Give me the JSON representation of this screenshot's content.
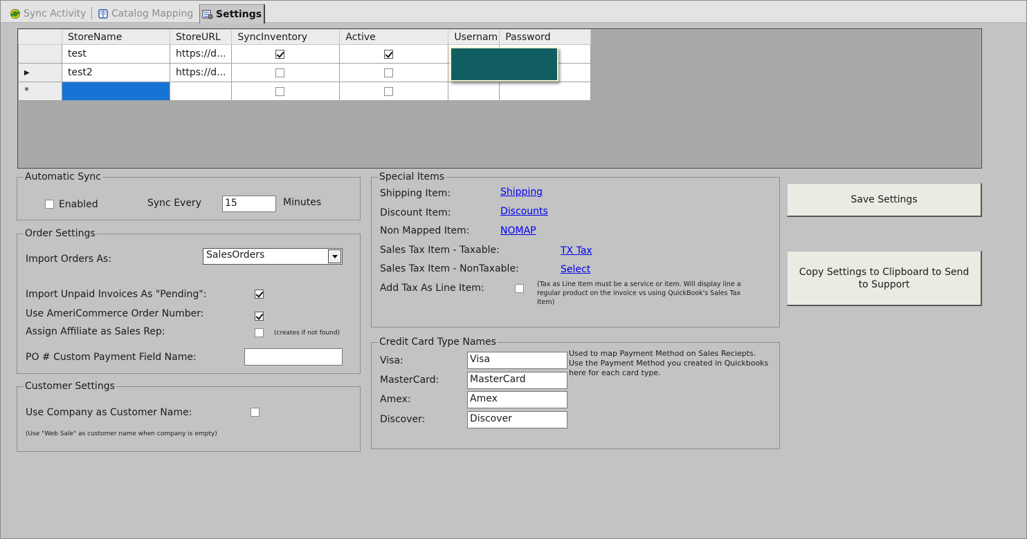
{
  "tabs": [
    {
      "label": "Sync Activity",
      "icon": "sync-icon"
    },
    {
      "label": "Catalog Mapping",
      "icon": "catalog-book-icon"
    },
    {
      "label": "Settings",
      "icon": "settings-icon"
    }
  ],
  "grid": {
    "columns": [
      "StoreName",
      "StoreURL",
      "SyncInventory",
      "Active",
      "Usernam",
      "Password"
    ],
    "rows": [
      {
        "row_marker": "",
        "store_name": "test",
        "store_url": "https://d...",
        "sync_inventory": true,
        "active": true
      },
      {
        "row_marker": "▶",
        "store_name": "test2",
        "store_url": "https://d...",
        "sync_inventory": false,
        "active": false
      },
      {
        "row_marker": "*",
        "store_name": "",
        "store_url": "",
        "sync_inventory": false,
        "active": false
      }
    ]
  },
  "automatic_sync": {
    "title": "Automatic Sync",
    "enabled_label": "Enabled",
    "enabled": false,
    "sync_every_label": "Sync Every",
    "interval_value": "15",
    "minutes_label": "Minutes"
  },
  "order_settings": {
    "title": "Order Settings",
    "import_as_label": "Import Orders As:",
    "import_as_value": "SalesOrders",
    "unpaid_pending_label": "Import Unpaid Invoices As \"Pending\":",
    "unpaid_pending": true,
    "ameri_order_number_label": "Use AmeriCommerce Order Number:",
    "ameri_order_number": true,
    "affiliate_rep_label": "Assign Affiliate as Sales Rep:",
    "affiliate_rep": false,
    "affiliate_note": "(creates if not found)",
    "po_field_label": "PO # Custom Payment Field Name:",
    "po_field_value": ""
  },
  "customer_settings": {
    "title": "Customer Settings",
    "company_as_name_label": "Use Company as Customer Name:",
    "company_as_name": false,
    "note": "(Use \"Web Sale\" as customer name when company is empty)"
  },
  "special_items": {
    "title": "Special Items",
    "shipping_label": "Shipping Item:",
    "shipping_value": "Shipping",
    "discount_label": "Discount Item:",
    "discount_value": "Discounts",
    "non_mapped_label": "Non Mapped Item:",
    "non_mapped_value": "NOMAP",
    "tax_taxable_label": "Sales Tax Item - Taxable:",
    "tax_taxable_value": "TX Tax",
    "tax_nontaxable_label": "Sales Tax Item - NonTaxable:",
    "tax_nontaxable_value": "Select",
    "add_tax_line_label": "Add Tax As Line Item:",
    "add_tax_line": false,
    "add_tax_note": "(Tax as Line Item must be a service or item.  Will display line a regular product on the invoice vs using QuickBook's Sales Tax Item)"
  },
  "credit_cards": {
    "title": "Credit Card Type Names",
    "visa_label": "Visa:",
    "visa_value": "Visa",
    "mastercard_label": "MasterCard:",
    "mastercard_value": "MasterCard",
    "amex_label": "Amex:",
    "amex_value": "Amex",
    "discover_label": "Discover:",
    "discover_value": "Discover",
    "note": "Used to map Payment Method on Sales Reciepts.  Use the Payment Method you created in Quickbooks here for each card type."
  },
  "buttons": {
    "save": "Save Settings",
    "copy": "Copy Settings to Clipboard to Send to Support"
  },
  "colors": {
    "background": "#c3c3c3",
    "selected_cell": "#1874d4",
    "redaction": "#115e62",
    "link": "#0000ee"
  }
}
